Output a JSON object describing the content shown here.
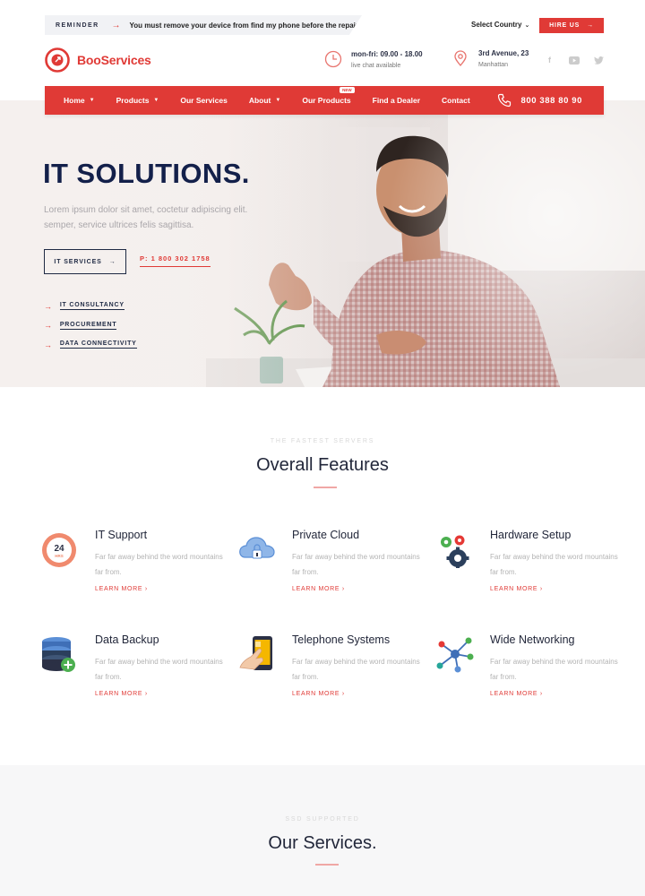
{
  "topbar": {
    "reminder_tag": "REMINDER",
    "reminder_text": "You must remove your device from find my phone before the repair.",
    "country": "Select Country",
    "hire_label": "HIRE US"
  },
  "header": {
    "logo": "BooServices",
    "hours_l1": "mon-fri: 09.00 - 18.00",
    "hours_l2": "live chat available",
    "addr_l1": "3rd Avenue, 23",
    "addr_l2": "Manhattan",
    "social": [
      "f",
      "youtube",
      "twitter"
    ]
  },
  "nav": {
    "items": [
      {
        "label": "Home",
        "dropdown": true
      },
      {
        "label": "Products",
        "dropdown": true
      },
      {
        "label": "Our Services",
        "dropdown": false
      },
      {
        "label": "About",
        "dropdown": true
      },
      {
        "label": "Our Products",
        "dropdown": false,
        "badge": "NEW"
      },
      {
        "label": "Find a Dealer",
        "dropdown": false
      },
      {
        "label": "Contact",
        "dropdown": false
      }
    ],
    "phone": "800 388 80 90"
  },
  "hero": {
    "title": "IT SOLUTIONS.",
    "subtitle": "Lorem ipsum dolor sit amet, coctetur adipiscing elit. semper, service ultrices felis sagittisa.",
    "button": "IT SERVICES",
    "phone": "P: 1 800 302 1758",
    "links": [
      "IT CONSULTANCY",
      "PROCUREMENT",
      "DATA CONNECTIVITY"
    ]
  },
  "features": {
    "kicker": "THE FASTEST SERVERS",
    "title": "Overall Features",
    "items": [
      {
        "title": "IT Support",
        "desc": "Far far away behind the word mountains far from.",
        "more": "LEARN MORE ›",
        "icon": "24-hours-support-icon"
      },
      {
        "title": "Private Cloud",
        "desc": "Far far away behind the word mountains far from.",
        "more": "LEARN MORE ›",
        "icon": "cloud-lock-icon"
      },
      {
        "title": "Hardware Setup",
        "desc": "Far far away behind the word mountains far from.",
        "more": "LEARN MORE ›",
        "icon": "gears-icon"
      },
      {
        "title": "Data Backup",
        "desc": "Far far away behind the word mountains far from.",
        "more": "LEARN MORE ›",
        "icon": "database-add-icon"
      },
      {
        "title": "Telephone Systems",
        "desc": "Far far away behind the word mountains far from.",
        "more": "LEARN MORE ›",
        "icon": "smartphone-touch-icon"
      },
      {
        "title": "Wide Networking",
        "desc": "Far far away behind the word mountains far from.",
        "more": "LEARN MORE ›",
        "icon": "network-nodes-icon"
      }
    ]
  },
  "services": {
    "kicker": "SSD SUPPORTED",
    "title": "Our Services."
  },
  "colors": {
    "accent": "#e03a36",
    "navy": "#13204a"
  }
}
